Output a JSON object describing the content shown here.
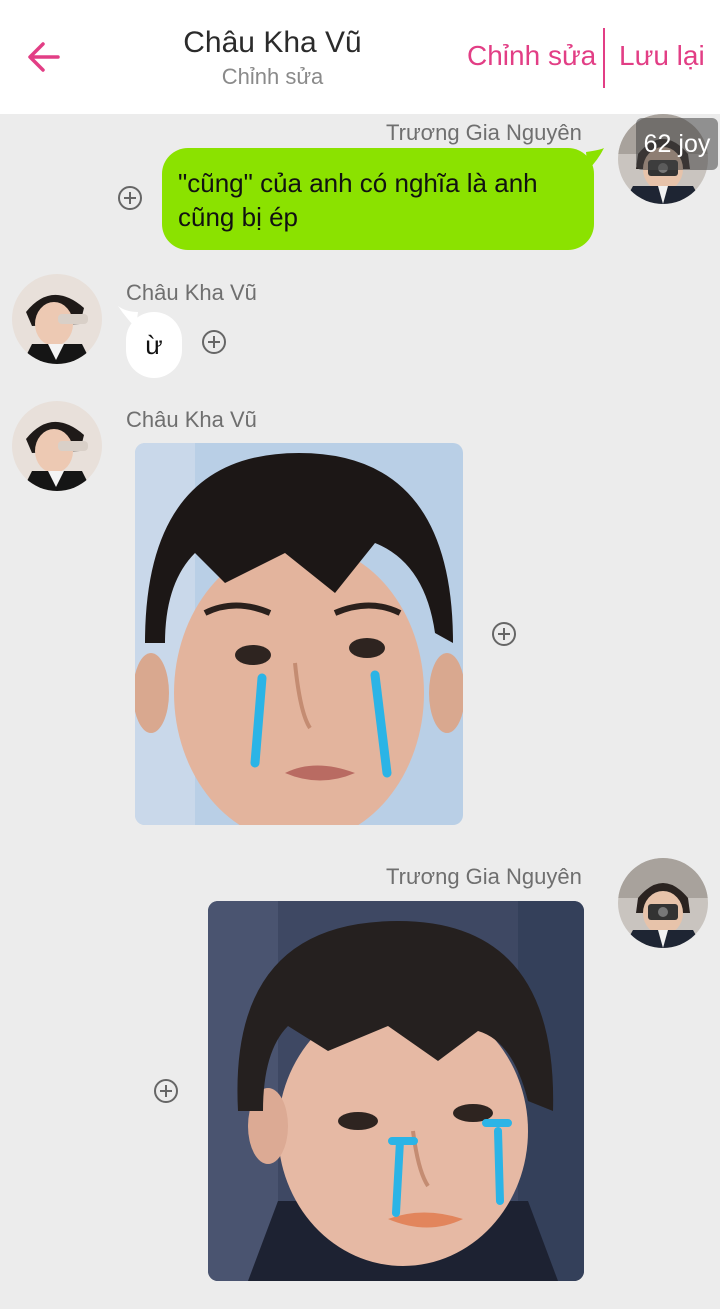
{
  "header": {
    "title": "Châu Kha Vũ",
    "subtitle": "Chỉnh sửa",
    "edit_label": "Chỉnh sửa",
    "save_label": "Lưu lại"
  },
  "messages": [
    {
      "sender": "Trương Gia Nguyên",
      "side": "right",
      "type": "text",
      "text": "\"cũng\" của anh có nghĩa là anh cũng bị ép",
      "bubble_color": "#8be200"
    },
    {
      "sender": "Châu Kha Vũ",
      "side": "left",
      "type": "text",
      "text": "ừ",
      "bubble_color": "#ffffff"
    },
    {
      "sender": "Châu Kha Vũ",
      "side": "left",
      "type": "image"
    },
    {
      "sender": "Trương Gia Nguyên",
      "side": "right",
      "type": "image"
    }
  ],
  "overlay_badge": "62 joy",
  "colors": {
    "accent": "#e23e85",
    "background": "#ececec",
    "green_bubble": "#8be200",
    "tear_blue": "#2bb4e6"
  }
}
